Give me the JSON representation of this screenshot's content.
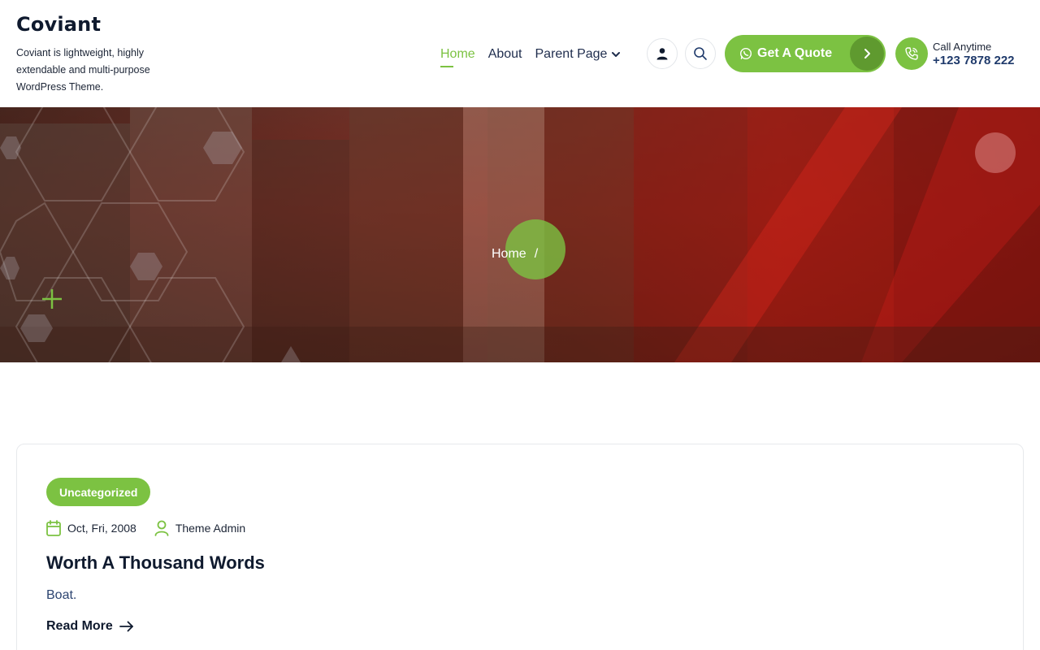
{
  "site": {
    "title": "Coviant",
    "tagline": "Coviant is lightweight, highly extendable and multi-purpose WordPress Theme."
  },
  "nav": {
    "items": [
      {
        "label": "Home",
        "active": true
      },
      {
        "label": "About",
        "active": false
      },
      {
        "label": "Parent Page",
        "active": false,
        "has_dropdown": true
      }
    ]
  },
  "header_icons": {
    "user": "user-icon",
    "search": "search-icon"
  },
  "quote_button": {
    "label": "Get A Quote",
    "icon": "whatsapp-icon",
    "arrow_icon": "chevron-right-icon"
  },
  "call": {
    "label": "Call Anytime",
    "number": "+123 7878 222",
    "icon": "phone-icon"
  },
  "hero": {
    "breadcrumb": [
      {
        "label": "Home"
      }
    ],
    "separator": "/"
  },
  "post": {
    "category": "Uncategorized",
    "date": "Oct, Fri, 2008",
    "author": "Theme Admin",
    "title": "Worth A Thousand Words",
    "excerpt": "Boat.",
    "read_more": "Read More"
  },
  "colors": {
    "accent": "#7cc242",
    "accent_dark": "#5f9a2f",
    "heading": "#0f1a2e",
    "link_blue": "#1f3a6b"
  }
}
